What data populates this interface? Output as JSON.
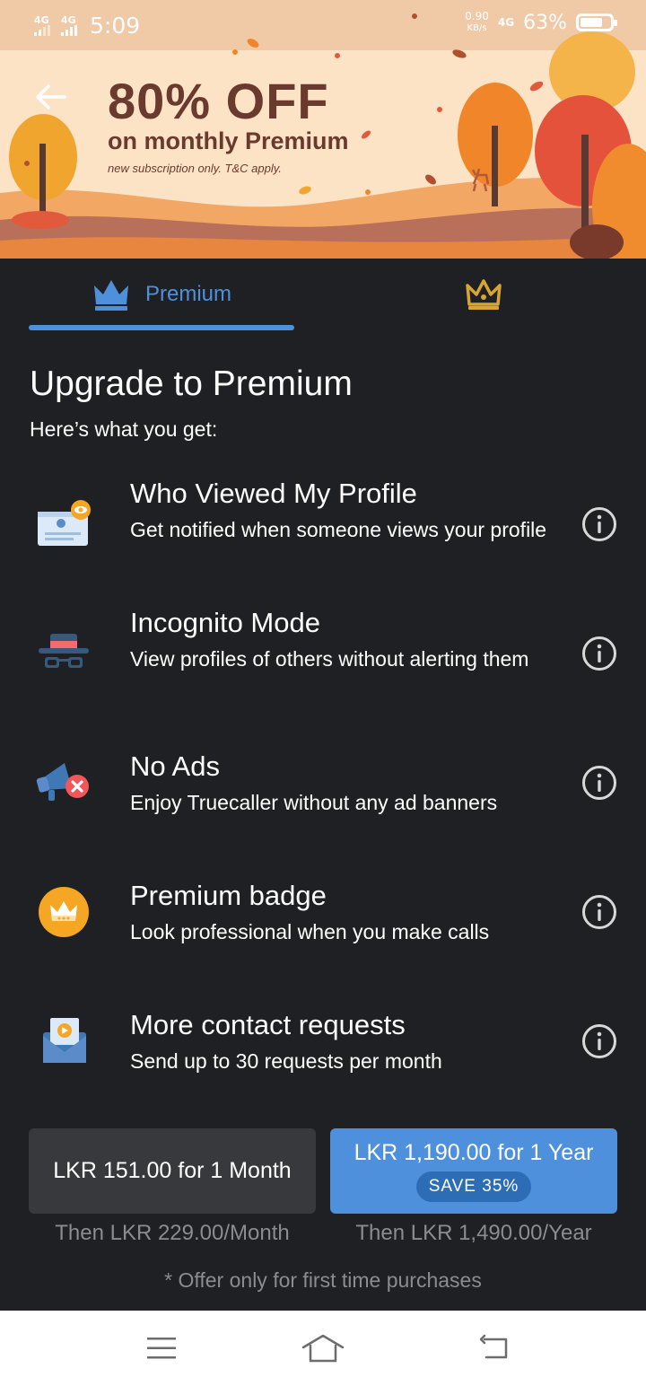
{
  "status_bar": {
    "sim1": "4G",
    "sim2": "4G",
    "time": "5:09",
    "speed_value": "0.90",
    "speed_unit": "KB/s",
    "network": "4G",
    "battery_percent": "63%"
  },
  "banner": {
    "title": "80% OFF",
    "subtitle": "on monthly Premium",
    "note": "new subscription only. T&C apply."
  },
  "tabs": {
    "premium_label": "Premium"
  },
  "header": {
    "title": "Upgrade to Premium",
    "subtitle": "Here’s what you get:"
  },
  "features": [
    {
      "title": "Who Viewed My Profile",
      "desc": "Get notified when someone views your profile",
      "icon": "profile-card-eye-icon"
    },
    {
      "title": "Incognito Mode",
      "desc": "View profiles of others without alerting them",
      "icon": "incognito-hat-glasses-icon"
    },
    {
      "title": "No Ads",
      "desc": "Enjoy Truecaller without any ad banners",
      "icon": "megaphone-blocked-icon"
    },
    {
      "title": "Premium badge",
      "desc": "Look professional when you make calls",
      "icon": "crown-badge-icon"
    },
    {
      "title": "More contact requests",
      "desc": "Send up to 30 requests per month",
      "icon": "envelope-icon"
    }
  ],
  "plans": {
    "month": {
      "price": "LKR 151.00 for 1 Month",
      "then": "Then LKR 229.00/Month"
    },
    "year": {
      "price": "LKR 1,190.00 for 1 Year",
      "badge": "SAVE 35%",
      "then": "Then LKR 1,490.00/Year"
    }
  },
  "disclaimer": "* Offer only for first time purchases",
  "colors": {
    "accent_blue": "#4f90dc",
    "gold": "#d9a532",
    "background": "#1f2023",
    "banner_text": "#6b3a2e"
  }
}
